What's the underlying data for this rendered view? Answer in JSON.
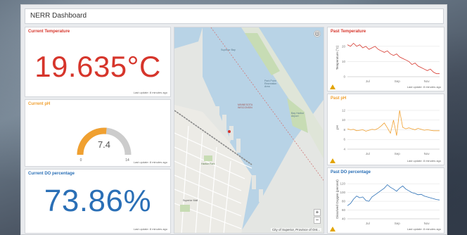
{
  "dashboard": {
    "title": "NERR Dashboard"
  },
  "current_temperature": {
    "title": "Current Temperature",
    "value": "19.635°C",
    "last_update": "Last update: 8 minutes ago",
    "color": "#d6352b"
  },
  "current_ph": {
    "title": "Current pH",
    "value": "7.4",
    "min": "0",
    "max": "14",
    "gauge_fraction": 0.53,
    "last_update": "Last update: 8 minutes ago",
    "color": "#f0a030"
  },
  "current_do": {
    "title": "Current DO percentage",
    "value": "73.86%",
    "last_update": "Last update: 8 minutes ago",
    "color": "#2a6fb6"
  },
  "map": {
    "labels": [
      "Superior Bay",
      "MINNESOTA WISCONSIN",
      "Park Point Recreation Area",
      "Bay Harbor Airport",
      "Harbor Park",
      "Superior Mall"
    ],
    "attribution": "City of Superior, Province of Ont...",
    "zoom_in": "+",
    "zoom_out": "−"
  },
  "past_temperature": {
    "title": "Past Temperature",
    "last_update": "Last update: 8 minutes ago",
    "color": "#d6352b"
  },
  "past_ph": {
    "title": "Past pH",
    "last_update": "Last update: 8 minutes ago",
    "color": "#f0a030"
  },
  "past_do": {
    "title": "Past DO percentage",
    "last_update": "Last update: 8 minutes ago",
    "color": "#2a6fb6"
  },
  "chart_data": [
    {
      "type": "line",
      "ylabel": "Temperature (°C)",
      "x_ticks": [
        "Jul",
        "Sep",
        "Nov"
      ],
      "y_ticks": [
        0,
        10,
        20
      ],
      "ylim": [
        0,
        25
      ],
      "series": [
        {
          "values": [
            21,
            20,
            22,
            20,
            21,
            19,
            20,
            18,
            19,
            20,
            18,
            17,
            16,
            17,
            15,
            14,
            15,
            13,
            12,
            11,
            10,
            8,
            9,
            7,
            6,
            5,
            4,
            5,
            3,
            2,
            2
          ]
        }
      ]
    },
    {
      "type": "line",
      "ylabel": "pH",
      "x_ticks": [
        "Jul",
        "Sep",
        "Nov"
      ],
      "y_ticks": [
        4,
        6,
        8,
        10,
        12
      ],
      "ylim": [
        4,
        13
      ],
      "series": [
        {
          "values": [
            8.2,
            8.0,
            8.1,
            7.8,
            7.9,
            8.0,
            7.7,
            7.9,
            8.1,
            8.0,
            8.3,
            8.8,
            9.4,
            8.4,
            7.3,
            10.0,
            6.8,
            12.0,
            8.5,
            8.2,
            8.4,
            8.2,
            8.0,
            8.3,
            8.1,
            7.9,
            8.0,
            7.9,
            7.8,
            7.8,
            7.8
          ]
        }
      ]
    },
    {
      "type": "line",
      "ylabel": "Dissolved Oxygen (percent)",
      "x_ticks": [
        "Jul",
        "Sep",
        "Nov"
      ],
      "y_ticks": [
        40,
        60,
        80,
        100,
        120
      ],
      "ylim": [
        40,
        130
      ],
      "series": [
        {
          "values": [
            70,
            75,
            85,
            92,
            88,
            90,
            82,
            80,
            90,
            95,
            100,
            105,
            110,
            118,
            112,
            108,
            103,
            110,
            115,
            108,
            104,
            100,
            98,
            95,
            96,
            92,
            90,
            88,
            86,
            84,
            83
          ]
        }
      ]
    }
  ]
}
